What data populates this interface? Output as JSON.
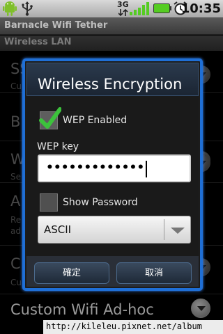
{
  "status_bar": {
    "network_type": "3G",
    "time": "10:35",
    "icons": [
      "android-icon",
      "usb-icon",
      "signal-icon",
      "battery-icon",
      "alarm-clock-icon"
    ]
  },
  "app": {
    "title": "Barnacle Wifi Tether",
    "section": "Wireless LAN"
  },
  "background_prefs": [
    {
      "title": "SS",
      "sub": "Cu"
    },
    {
      "title": "B",
      "sub": ""
    },
    {
      "title": "W",
      "sub": "Se"
    },
    {
      "title": "A",
      "sub": "Re",
      "sub2": "ad"
    },
    {
      "title": "C",
      "sub": "Cu"
    }
  ],
  "footer_pref": {
    "title": "Custom Wifi Ad-hoc"
  },
  "watermark": "http://kileleu.pixnet.net/album",
  "dialog": {
    "title": "Wireless Encryption",
    "wep_enabled": {
      "label": "WEP Enabled",
      "checked": true
    },
    "wep_key": {
      "label": "WEP key",
      "value": "•••••••••••••"
    },
    "show_password": {
      "label": "Show Password",
      "checked": false
    },
    "encoding": {
      "selected": "ASCII"
    },
    "buttons": {
      "ok": "確定",
      "cancel": "取消"
    }
  },
  "colors": {
    "dialog_border": "#1f6fd6",
    "checkmark": "#3cc23c",
    "battery": "#55cc22"
  }
}
